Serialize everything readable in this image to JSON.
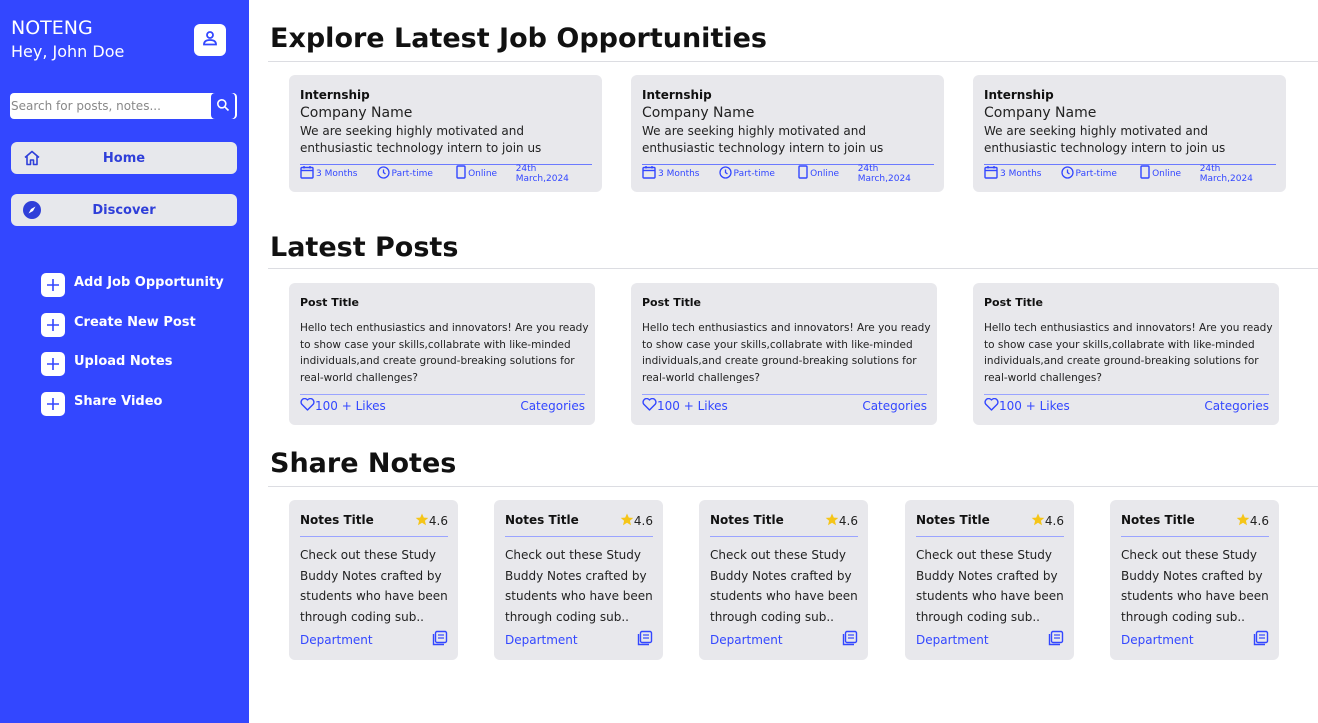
{
  "app": {
    "brand": "NOTENG",
    "greeting": "Hey, John Doe",
    "accent": "#3347ff"
  },
  "search": {
    "placeholder": "Search for posts, notes..."
  },
  "nav": {
    "home": "Home",
    "discover": "Discover"
  },
  "actions": [
    {
      "label": "Add Job Opportunity",
      "icon": "plus-icon"
    },
    {
      "label": "Create New Post",
      "icon": "plus-icon"
    },
    {
      "label": "Upload Notes",
      "icon": "plus-icon"
    },
    {
      "label": "Share Video",
      "icon": "plus-icon"
    }
  ],
  "sections": {
    "jobs": "Explore Latest Job Opportunities",
    "posts": "Latest Posts",
    "notes": "Share Notes"
  },
  "jobs": [
    {
      "type": "Internship",
      "company": "Company Name",
      "description": "We are seeking highly motivated and enthusiastic technology intern to join us",
      "duration": "3 Months",
      "schedule": "Part-time",
      "mode": "Online",
      "date": "24th March,2024"
    },
    {
      "type": "Internship",
      "company": "Company Name",
      "description": "We are seeking highly motivated and enthusiastic technology intern to join us",
      "duration": "3 Months",
      "schedule": "Part-time",
      "mode": "Online",
      "date": "24th March,2024"
    },
    {
      "type": "Internship",
      "company": "Company Name",
      "description": "We are seeking highly motivated and enthusiastic technology intern to join us",
      "duration": "3 Months",
      "schedule": "Part-time",
      "mode": "Online",
      "date": "24th March,2024"
    }
  ],
  "posts": [
    {
      "title": "Post Title",
      "body": "Hello tech enthusiastics and innovators! Are you ready to show case your skills,collabrate with like-minded individuals,and create ground-breaking solutions for real-world challenges?",
      "likes": "100 + Likes",
      "categories": "Categories"
    },
    {
      "title": "Post Title",
      "body": "Hello tech enthusiastics and innovators! Are you ready to show case your skills,collabrate with like-minded individuals,and create ground-breaking solutions for real-world challenges?",
      "likes": "100 + Likes",
      "categories": "Categories"
    },
    {
      "title": "Post Title",
      "body": "Hello tech enthusiastics and innovators! Are you ready to show case your skills,collabrate with like-minded individuals,and create ground-breaking solutions for real-world challenges?",
      "likes": "100 + Likes",
      "categories": "Categories"
    }
  ],
  "notes": [
    {
      "title": "Notes Title",
      "rating": "4.6",
      "body": "Check out these Study Buddy Notes crafted by students who have been through coding sub..",
      "department": "Department"
    },
    {
      "title": "Notes Title",
      "rating": "4.6",
      "body": "Check out these Study Buddy Notes crafted by students who have been through coding sub..",
      "department": "Department"
    },
    {
      "title": "Notes Title",
      "rating": "4.6",
      "body": "Check out these Study Buddy Notes crafted by students who have been through coding sub..",
      "department": "Department"
    },
    {
      "title": "Notes Title",
      "rating": "4.6",
      "body": "Check out these Study Buddy Notes crafted by students who have been through coding sub..",
      "department": "Department"
    },
    {
      "title": "Notes Title",
      "rating": "4.6",
      "body": "Check out these Study Buddy Notes crafted by students who have been through coding sub..",
      "department": "Department"
    }
  ]
}
